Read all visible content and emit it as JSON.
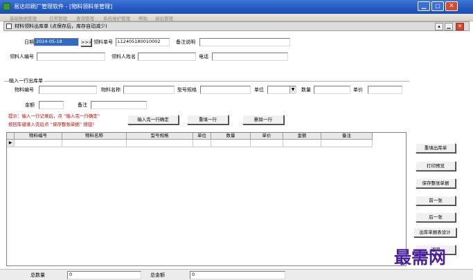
{
  "window": {
    "title": "易达印刷厂管理软件 - [物料领料单管理]",
    "controls": [
      "minimize",
      "maximize",
      "close"
    ]
  },
  "menu": {
    "items": [
      "基础数据管理",
      "日常管理",
      "查询管理",
      "系统维护管理",
      "帮助",
      "退出管理"
    ]
  },
  "form_title": "材料领料出库单 (点保存后，库存自动减少)",
  "header_fields": {
    "date_label": "日期",
    "date_value": "2024-05-18",
    "date_button": ">>>",
    "order_no_label": "领料单号",
    "order_no_value": "L12405180010002",
    "remark_label": "备注说明",
    "remark_value": "",
    "picker_code_label": "领料人编号",
    "picker_code_value": "",
    "picker_name_label": "领料人姓名",
    "picker_name_value": "",
    "phone_label": "电话",
    "phone_value": ""
  },
  "entry_section": {
    "title": "输入一行出库单",
    "material_code_label": "物料编号",
    "material_name_label": "物料名称",
    "spec_label": "型号规格",
    "unit_label": "单位",
    "qty_label": "数量",
    "price_label": "单价",
    "amount_label": "金额",
    "note_label": "备注",
    "values": {
      "material_code": "",
      "material_name": "",
      "spec": "",
      "unit": "",
      "qty": "",
      "price": "",
      "amount": "",
      "note": ""
    }
  },
  "hints": {
    "line1": "提示：输入一行记录后，点 “输入完一行确定”",
    "line2": "按回车键录入完后点 “保存整张单据” 按钮！",
    "color": "#d00000"
  },
  "entry_buttons": {
    "confirm_row": "输入完一行确定",
    "refill_row": "重填一行",
    "delete_row": "删除一行"
  },
  "table": {
    "columns": [
      "物料编号",
      "物料名称",
      "型号规格",
      "单位",
      "数量",
      "单价",
      "金额",
      "备注"
    ],
    "rows": [
      [
        "",
        "",
        "",
        "",
        "",
        "",
        "",
        ""
      ]
    ]
  },
  "side_buttons": {
    "refill_order": "重填出库单",
    "print_preview": "打印预览",
    "save_order": "保存整张单据",
    "previous": "前一张",
    "next": "后一张",
    "report_design": "出库单据表设计",
    "back": "返回"
  },
  "status": {
    "total_qty_label": "总数量",
    "total_qty_value": "0",
    "total_amount_label": "总金额",
    "total_amount_value": "0"
  },
  "watermark": "最需网",
  "colors": {
    "titlebar": "#2459c3",
    "date_highlight": "#316ac5",
    "watermark": "#4a1f9e"
  }
}
